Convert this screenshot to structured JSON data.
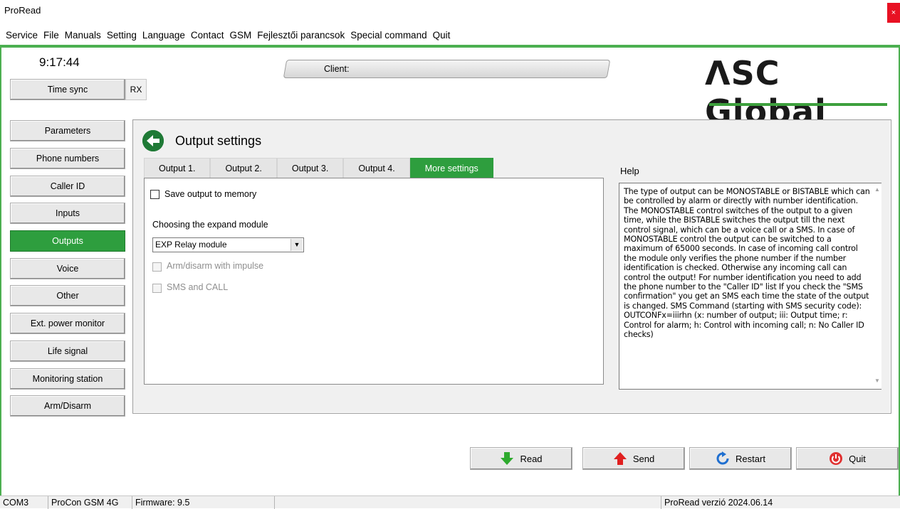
{
  "window": {
    "title": "ProRead",
    "close_label": "×"
  },
  "menu": [
    "Service",
    "File",
    "Manuals",
    "Setting",
    "Language",
    "Contact",
    "GSM",
    "Fejlesztői parancsok",
    "Special command",
    "Quit"
  ],
  "header": {
    "time": "9:17:44",
    "time_sync_label": "Time sync",
    "rx_label": "RX",
    "client_label": "Client:",
    "logo_text": "ΛSC Global",
    "accent_color": "#2e9e3e"
  },
  "sidebar": {
    "items": [
      {
        "label": "Parameters"
      },
      {
        "label": "Phone numbers"
      },
      {
        "label": "Caller ID"
      },
      {
        "label": "Inputs"
      },
      {
        "label": "Outputs"
      },
      {
        "label": "Voice"
      },
      {
        "label": "Other"
      },
      {
        "label": "Ext. power monitor"
      },
      {
        "label": "Life signal"
      },
      {
        "label": "Monitoring station"
      },
      {
        "label": "Arm/Disarm"
      }
    ],
    "active": "Outputs"
  },
  "panel": {
    "title": "Output settings",
    "tabs": [
      {
        "label": "Output 1."
      },
      {
        "label": "Output 2."
      },
      {
        "label": "Output 3."
      },
      {
        "label": "Output 4."
      },
      {
        "label": "More settings"
      }
    ],
    "active_tab": "More settings",
    "save_output_label": "Save output to memory",
    "save_output_checked": false,
    "expand_module_label": "Choosing the expand module",
    "expand_module_value": "EXP Relay module",
    "arm_disarm_label": "Arm/disarm with impulse",
    "sms_call_label": "SMS and CALL"
  },
  "help": {
    "label": "Help",
    "text": "The type of output can be MONOSTABLE or BISTABLE which can be controlled by alarm or directly with number identification.  The MONOSTABLE control switches of the output to a given time, while the BISTABLE switches the output till the next control signal, which can be a voice call or a SMS. In case of MONOSTABLE control the output can be switched to a maximum of 65000 seconds. In case of incoming call control the module only verifies the phone number if the number identification is checked. Otherwise any incoming call can control the output! For number identification you need to add the phone number to the \"Caller ID\" list If you check the \"SMS confirmation\" you get an SMS each time the state of the output is changed. SMS Command (starting with SMS security code): OUTCONFx=iiirhn (x: number of output; iii: Output time; r: Control for alarm; h: Control with incoming call; n: No Caller ID checks)"
  },
  "actions": {
    "read": "Read",
    "send": "Send",
    "restart": "Restart",
    "quit": "Quit"
  },
  "status": {
    "port": "COM3",
    "device": "ProCon GSM 4G",
    "firmware": "Firmware: 9.5",
    "version": "ProRead verzió 2024.06.14"
  }
}
